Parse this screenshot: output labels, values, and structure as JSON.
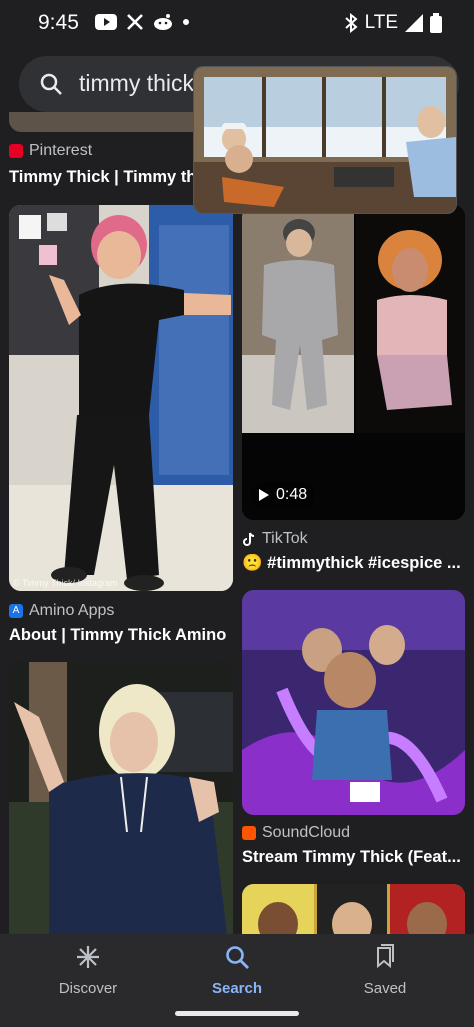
{
  "status": {
    "time": "9:45",
    "network": "LTE"
  },
  "search": {
    "query": "timmy thick"
  },
  "results": {
    "r1": {
      "source": "Pinterest",
      "title": "Timmy Thick | Timmy thi"
    },
    "r2": {
      "source": "Amino Apps",
      "title": "About | Timmy Thick Amino",
      "watermark": "© Timmy Thick/ Instagram"
    },
    "r3": {
      "source": "TikTok",
      "title": "#timmythick #icespice ...",
      "duration": "0:48",
      "emoji": "🙁"
    },
    "r4": {
      "source": "SoundCloud",
      "title": "Stream Timmy Thick (Feat..."
    }
  },
  "nav": {
    "discover": "Discover",
    "search": "Search",
    "saved": "Saved"
  },
  "colors": {
    "background": "#1f1f21",
    "accent": "#8ab4f8",
    "pinterest": "#e60023",
    "soundcloud": "#ff5500"
  }
}
